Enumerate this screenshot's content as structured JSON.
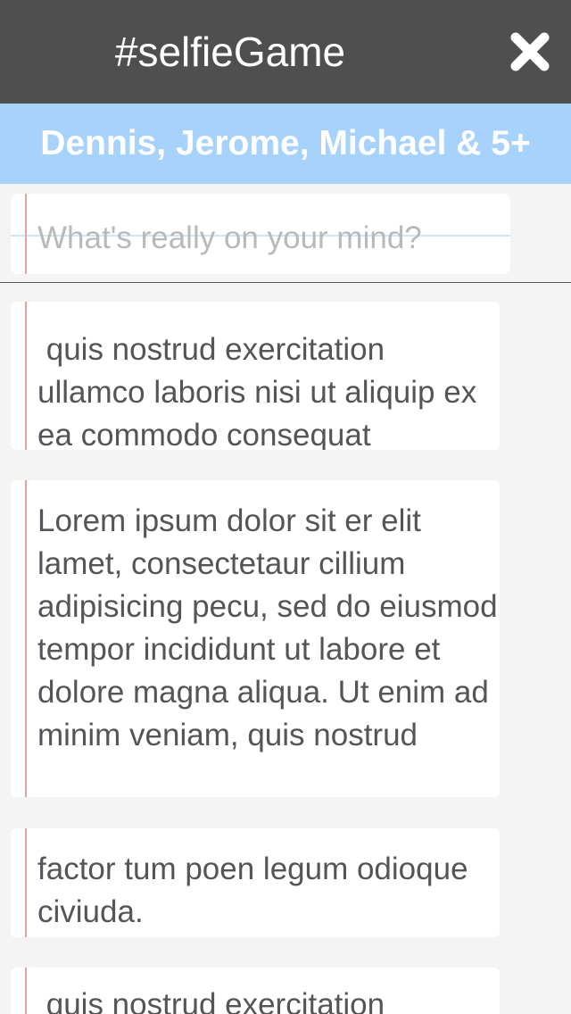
{
  "header": {
    "title": "#selfieGame",
    "close_icon": "close-x-icon"
  },
  "participants": {
    "label": "Dennis, Jerome, Michael & 5+"
  },
  "compose": {
    "placeholder": "What's really on your mind?",
    "value": ""
  },
  "notes": [
    {
      "text": " quis nostrud exercitation ullamco laboris nisi ut aliquip ex ea commodo consequat"
    },
    {
      "text": "Lorem ipsum dolor sit er elit lamet, consectetaur cillium adipisicing pecu, sed do eiusmod tempor incididunt ut labore et dolore magna aliqua. Ut enim ad minim veniam, quis nostrud"
    },
    {
      "text": "factor tum poen legum odioque civiuda."
    },
    {
      "text": " quis nostrud exercitation"
    }
  ],
  "colors": {
    "header_bg": "#4f4f4f",
    "participants_bg": "#a6d2fb",
    "paper_line": "#cfe7f5",
    "margin_line": "#e3a1a1",
    "text": "#555555"
  }
}
